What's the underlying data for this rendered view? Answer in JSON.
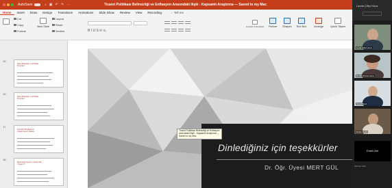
{
  "titlebar": {
    "autosave_label": "AutoSave",
    "title": "Ticaret Politikası Belirsizliği ve Enflasyon Arasındaki İlişki - Kapsamlı Araştırma — Saved to my Mac",
    "colors": {
      "bar": "#c43e1c"
    }
  },
  "ribbon_tabs": [
    "Home",
    "Insert",
    "Draw",
    "Design",
    "Transitions",
    "Animations",
    "Slide Show",
    "Review",
    "View",
    "Recording"
  ],
  "tell_me": "Tell me",
  "ribbon": {
    "cut": "Cut",
    "copy": "Copy",
    "format": "Format",
    "new_slide": "New Slide",
    "layout": "Layout",
    "reset": "Reset",
    "section": "Section",
    "convert_smartart": "Convert to SmartArt",
    "picture": "Picture",
    "shapes": "Shapes",
    "text_box": "Text Box",
    "arrange": "Arrange",
    "quick_styles": "Quick Styles",
    "format_symbols": "B  I  U  S  x²  x₂",
    "icons": {
      "paste": "paste-icon",
      "new_slide": "new-slide-icon",
      "picture": "picture-icon",
      "shapes": "shapes-icon",
      "text_box": "text-box-icon",
      "arrange": "arrange-icon"
    }
  },
  "thumbnails": [
    {
      "number": "15",
      "title": "Olası Bulgular ve Politika Önerileri"
    },
    {
      "number": "16",
      "title": "Olası Bulgular ve Politika Önerileri"
    },
    {
      "number": "17",
      "title": "Literatür Boşluğu ve Araştırmanın Katkısı"
    },
    {
      "number": "18",
      "title": "Metodoloji Seçimi: Neden Bu Yöntem?"
    }
  ],
  "slide": {
    "thanks": "Dinlediğiniz için teşekkürler",
    "author": "Dr. Öğr. Üyesi MERT GÜL",
    "tooltip": "Ticaret Politikası Belirsizliği ve Enflasyon Arasındaki İlişki - Kapsamlı Araştırma — Saved to my Mac"
  },
  "video_panel": {
    "top_name": "Lamia Çiftçi Hoca",
    "participants": [
      {
        "label": "Leyla Çiftçi Hoca"
      },
      {
        "label": "Bu Bir Dünya Hoca"
      },
      {
        "label": "Cemil Benli"
      },
      {
        "label": "Erhan Aydın"
      }
    ],
    "black_tile_name": "Emek Atıl",
    "footer": "Hizmet Tıkla"
  }
}
